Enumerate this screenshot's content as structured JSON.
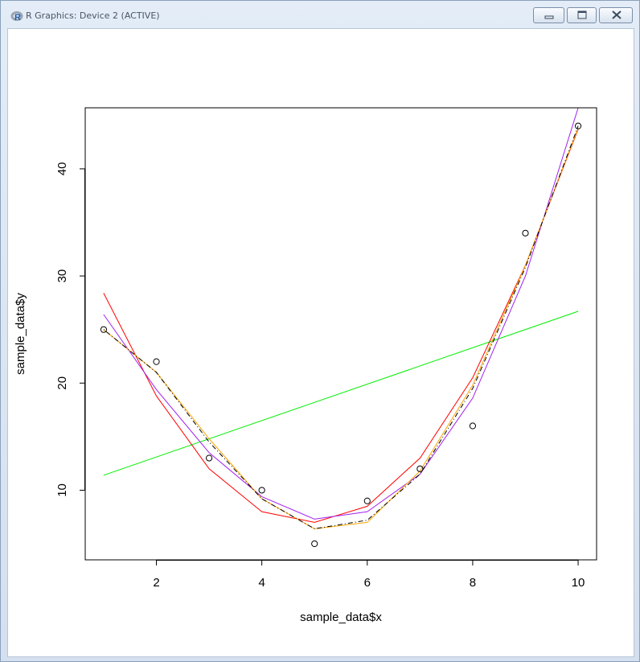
{
  "window": {
    "title": "R Graphics: Device 2 (ACTIVE)",
    "app_icon": "r-logo-icon",
    "buttons": [
      "minimize-icon",
      "maximize-icon",
      "close-icon"
    ]
  },
  "chart_data": {
    "type": "scatter",
    "xlabel": "sample_data$x",
    "ylabel": "sample_data$y",
    "xlim": [
      0.65,
      10.35
    ],
    "ylim": [
      3.5,
      45.7
    ],
    "x_ticks": [
      2,
      4,
      6,
      8,
      10
    ],
    "y_ticks": [
      10,
      20,
      30,
      40
    ],
    "grid": false,
    "points": {
      "x": [
        1,
        2,
        3,
        4,
        5,
        6,
        7,
        8,
        9,
        10
      ],
      "y": [
        25,
        22,
        13,
        10,
        5,
        9,
        12,
        16,
        34,
        44
      ]
    },
    "series": [
      {
        "color": "#00ee00",
        "x": [
          1,
          10
        ],
        "y": [
          11.4,
          26.7
        ]
      },
      {
        "color": "#ff0000",
        "x": [
          1,
          2,
          3,
          4,
          5,
          6,
          7,
          8,
          9,
          10
        ],
        "y": [
          28.4,
          18.8,
          12.0,
          8.0,
          7.0,
          8.5,
          13.0,
          20.5,
          31.0,
          43.7
        ]
      },
      {
        "color": "#a020f0",
        "x": [
          1,
          2,
          3,
          4,
          5,
          6,
          7,
          8,
          9,
          10
        ],
        "y": [
          26.4,
          19.4,
          13.5,
          9.4,
          7.3,
          8.0,
          11.5,
          18.6,
          30.0,
          45.7
        ]
      },
      {
        "color": "#ffa500",
        "x": [
          1,
          2,
          3,
          4,
          5,
          6,
          7,
          8,
          9,
          10
        ],
        "y": [
          25.0,
          21.0,
          14.8,
          9.2,
          6.4,
          7.0,
          11.8,
          19.8,
          31.0,
          43.8
        ]
      },
      {
        "color": "#000000",
        "x": [
          1,
          2,
          3,
          4,
          5,
          6,
          7,
          8,
          9,
          10
        ],
        "y": [
          25.0,
          21.0,
          14.5,
          9.2,
          6.4,
          7.2,
          11.5,
          19.5,
          30.8,
          44.0
        ],
        "dash": "dotdash"
      }
    ]
  }
}
